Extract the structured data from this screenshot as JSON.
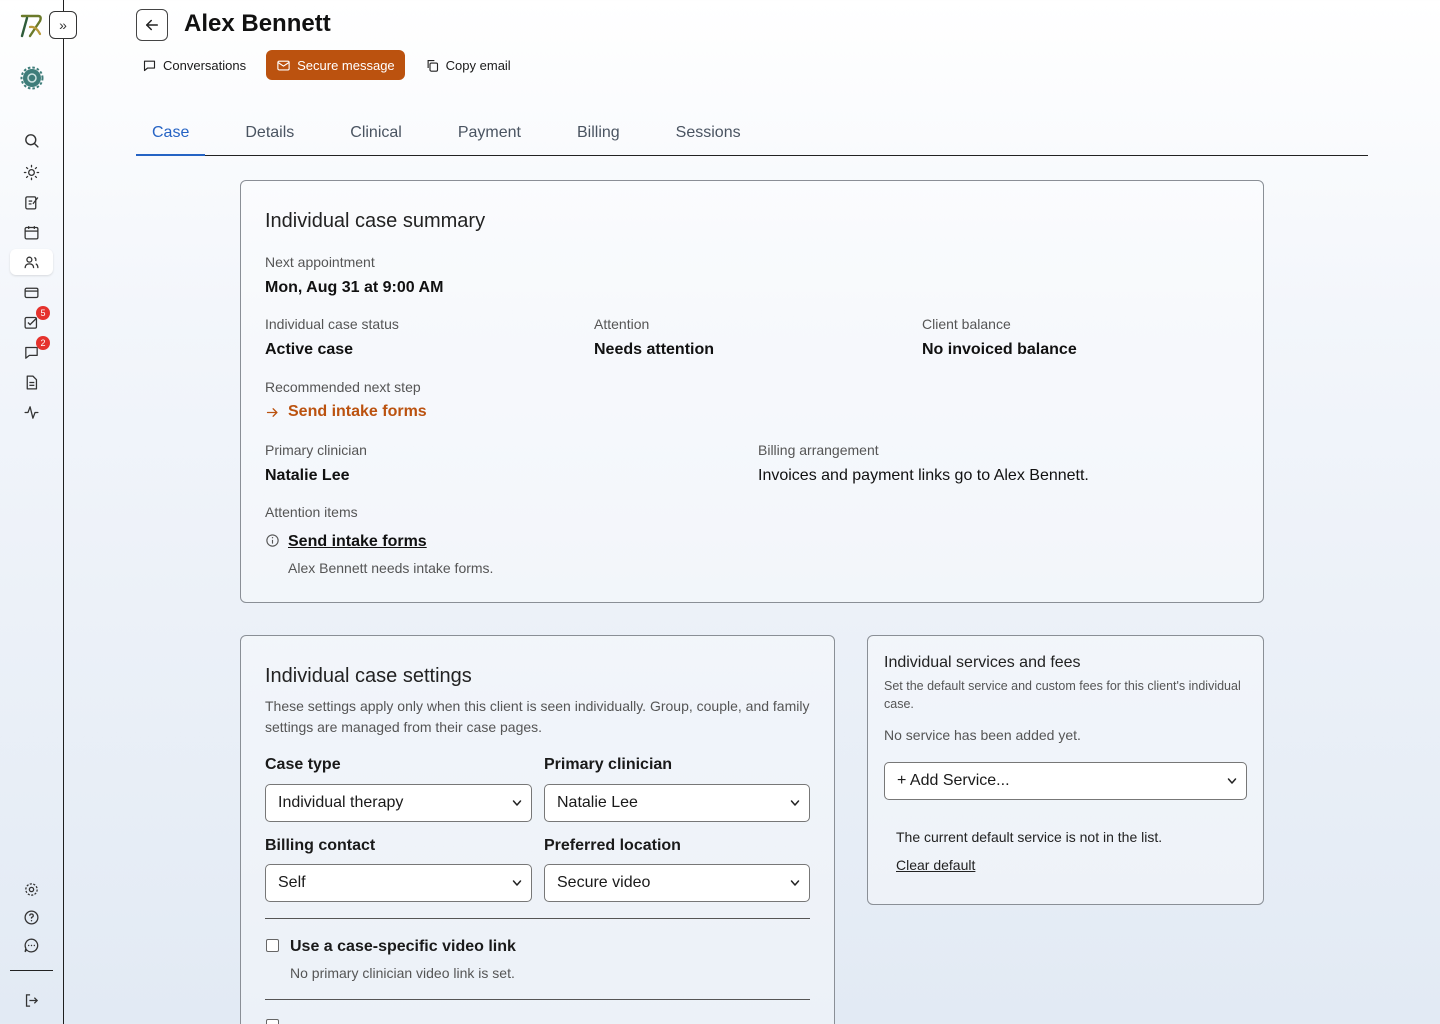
{
  "sidebar": {
    "expand_label": "»",
    "badges": {
      "tasks": "5",
      "messages": "2"
    }
  },
  "header": {
    "title": "Alex Bennett",
    "actions": {
      "conversations": "Conversations",
      "secure_message": "Secure message",
      "copy_email": "Copy email"
    }
  },
  "tabs": [
    "Case",
    "Details",
    "Clinical",
    "Payment",
    "Billing",
    "Sessions"
  ],
  "summary": {
    "title": "Individual case summary",
    "next_appointment_label": "Next appointment",
    "next_appointment_value": "Mon, Aug 31 at 9:00 AM",
    "status_label": "Individual case status",
    "status_value": "Active case",
    "attention_label": "Attention",
    "attention_value": "Needs attention",
    "balance_label": "Client balance",
    "balance_value": "No invoiced balance",
    "next_step_label": "Recommended next step",
    "next_step_value": "Send intake forms",
    "clinician_label": "Primary clinician",
    "clinician_value": "Natalie Lee",
    "billing_label": "Billing arrangement",
    "billing_value": "Invoices and payment links go to Alex Bennett.",
    "attention_items_label": "Attention items",
    "attention_item_title": "Send intake forms",
    "attention_item_desc": "Alex Bennett needs intake forms."
  },
  "settings": {
    "title": "Individual case settings",
    "description": "These settings apply only when this client is seen individually. Group, couple, and family settings are managed from their case pages.",
    "case_type_label": "Case type",
    "case_type_value": "Individual therapy",
    "primary_clinician_label": "Primary clinician",
    "primary_clinician_value": "Natalie Lee",
    "billing_contact_label": "Billing contact",
    "billing_contact_value": "Self",
    "preferred_location_label": "Preferred location",
    "preferred_location_value": "Secure video",
    "video_link_label": "Use a case-specific video link",
    "video_link_desc": "No primary clinician video link is set."
  },
  "services": {
    "title": "Individual services and fees",
    "description": "Set the default service and custom fees for this client's individual case.",
    "empty_text": "No service has been added yet.",
    "add_service": "+ Add Service...",
    "default_missing": "The current default service is not in the list.",
    "clear_default": "Clear default"
  },
  "colors": {
    "accent": "#2563c4",
    "brand_orange": "#bb520f",
    "badge_red": "#e5322d"
  }
}
